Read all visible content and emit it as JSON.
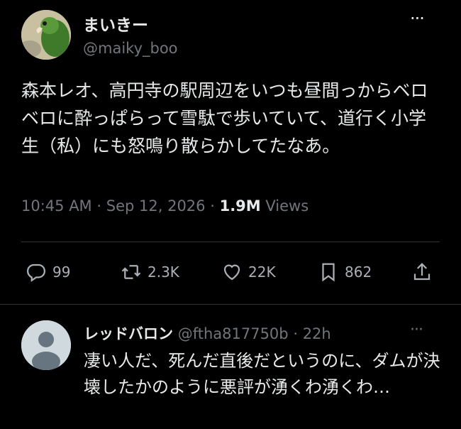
{
  "tweet": {
    "author_name": "まいきー",
    "author_handle": "@maiky_boo",
    "more": "···",
    "text": "森本レオ、高円寺の駅周辺をいつも昼間っからベロベロに酔っぱらって雪駄で歩いていて、道行く小学生（私）にも怒鳴り散らかしてたなあ。",
    "time": "10:45 AM",
    "separator": "·",
    "date": "Sep 12, 2026",
    "views_count": "1.9M",
    "views_label": "Views"
  },
  "actions": [
    {
      "icon": "reply-icon",
      "count": "99"
    },
    {
      "icon": "retweet-icon",
      "count": "2.3K"
    },
    {
      "icon": "like-icon",
      "count": "22K"
    },
    {
      "icon": "bookmark-icon",
      "count": "862"
    },
    {
      "icon": "share-icon",
      "count": ""
    }
  ],
  "reply": {
    "author_name": "レッドバロン",
    "author_handle": "@ftha817750b",
    "separator": "·",
    "age": "22h",
    "more": "···",
    "text": "凄い人だ、死んだ直後だというのに、ダムが決壊したかのように悪評が湧くわ湧くわ…"
  },
  "colors": {
    "background": "#000000",
    "text": "#e7e9ea",
    "muted": "#71767b",
    "divider": "#2f3336"
  }
}
